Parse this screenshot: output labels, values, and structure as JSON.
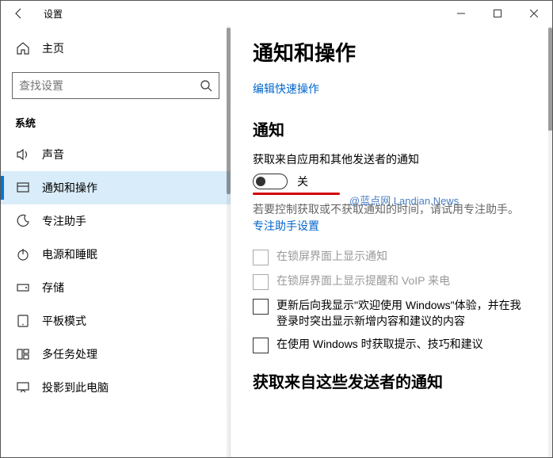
{
  "titlebar": {
    "title": "设置"
  },
  "sidebar": {
    "home": "主页",
    "search_placeholder": "查找设置",
    "category": "系统",
    "items": [
      {
        "label": "声音"
      },
      {
        "label": "通知和操作"
      },
      {
        "label": "专注助手"
      },
      {
        "label": "电源和睡眠"
      },
      {
        "label": "存储"
      },
      {
        "label": "平板模式"
      },
      {
        "label": "多任务处理"
      },
      {
        "label": "投影到此电脑"
      }
    ]
  },
  "content": {
    "heading": "通知和操作",
    "edit_quick_actions": "编辑快速操作",
    "notifications_heading": "通知",
    "get_notif_label": "获取来自应用和其他发送者的通知",
    "toggle_state": "关",
    "help_text": "若要控制获取或不获取通知的时间，请试用专注助手。",
    "focus_link": "专注助手设置",
    "checkboxes": [
      {
        "label": "在锁屏界面上显示通知",
        "disabled": true
      },
      {
        "label": "在锁屏界面上显示提醒和 VoIP 来电",
        "disabled": true
      },
      {
        "label": "更新后向我显示\"欢迎使用 Windows\"体验，并在我登录时突出显示新增内容和建议的内容",
        "disabled": false
      },
      {
        "label": "在使用 Windows 时获取提示、技巧和建议",
        "disabled": false
      }
    ],
    "senders_heading": "获取来自这些发送者的通知"
  },
  "watermark": "@蓝点网 Landian.News"
}
